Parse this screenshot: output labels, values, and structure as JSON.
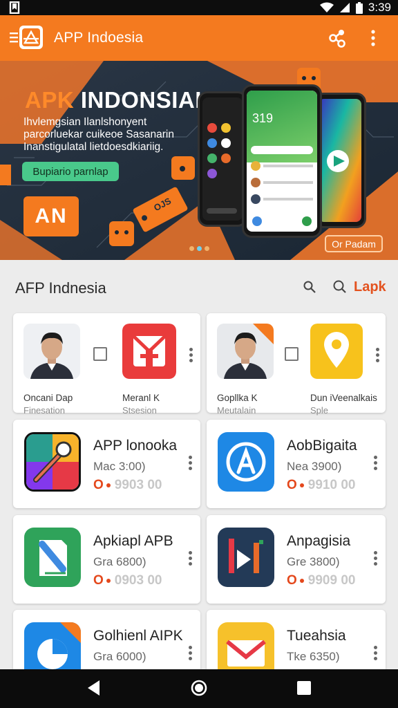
{
  "status_bar": {
    "time": "3:39"
  },
  "app_bar": {
    "title": "APP Indoesia"
  },
  "banner": {
    "title_accent": "APK",
    "title_rest": "INDONSIAI",
    "subtitle": "Ihvlemgsian Ilanlshonyent parcorluekar cuikeoe Sasanarin Inanstigulatal lietdoesdkiariig.",
    "cta": "Bupiario parnlap",
    "logo_text": "AN",
    "phone_clock": "319",
    "tag_text": "OJS",
    "button": "Or Padam"
  },
  "section": {
    "title": "AFP Indnesia",
    "link": "Lapk"
  },
  "top_cards": [
    {
      "items": [
        {
          "name": "Oncani Dap",
          "sub": "Finesation",
          "thumb": "person-avatar"
        },
        {
          "name": "Meranl K",
          "sub": "Stsesion",
          "thumb": "gift-icon"
        }
      ]
    },
    {
      "items": [
        {
          "name": "Gopllka K",
          "sub": "Meutalain",
          "thumb": "person-avatar",
          "badge": "NEW"
        },
        {
          "name": "Dun iVeenalkais",
          "sub": "Sple",
          "thumb": "location-pin-icon"
        }
      ]
    }
  ],
  "apps": [
    {
      "name": "APP lonooka",
      "meta": "Mac 3:00)",
      "rating": "O",
      "stats": "9903 00",
      "icon": "paint-tool-icon",
      "colors": [
        "#e63946",
        "#f77f00",
        "#2a9d8f",
        "#8338ec"
      ]
    },
    {
      "name": "AobBigaita",
      "meta": "Nea 3900)",
      "rating": "O",
      "stats": "9910 00",
      "icon": "app-store-icon",
      "colors": [
        "#1e88e5"
      ]
    },
    {
      "name": "Apkiapl APB",
      "meta": "Gra 6800)",
      "rating": "O",
      "stats": "0903 00",
      "icon": "document-edit-icon",
      "colors": [
        "#2fa35a"
      ]
    },
    {
      "name": "Anpagisia",
      "meta": "Gre 3800)",
      "rating": "O",
      "stats": "9909 00",
      "icon": "play-media-icon",
      "colors": [
        "#233a57"
      ]
    },
    {
      "name": "Golhienl AIPK",
      "meta": "Gra 6000)",
      "icon": "chart-pie-icon",
      "colors": [
        "#1e88e5"
      ],
      "badge": "NEW"
    },
    {
      "name": "Tueahsia",
      "meta": "Tke 6350)",
      "icon": "mail-icon",
      "colors": [
        "#f6c12b"
      ]
    }
  ]
}
